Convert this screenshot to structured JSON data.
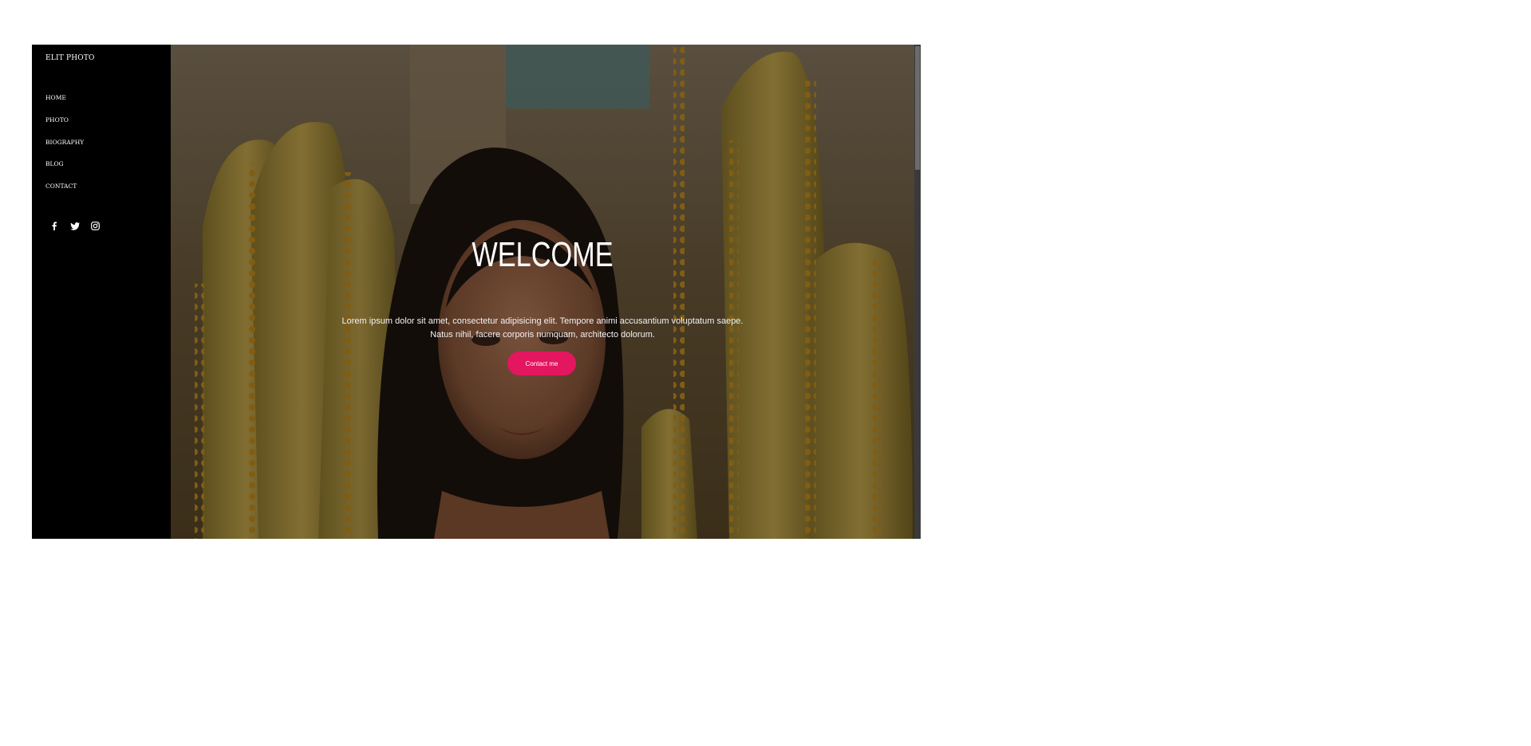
{
  "brand": "ELIT PHOTO",
  "nav": {
    "items": [
      {
        "label": "HOME"
      },
      {
        "label": "PHOTO"
      },
      {
        "label": "BIOGRAPHY"
      },
      {
        "label": "BLOG"
      },
      {
        "label": "CONTACT"
      }
    ]
  },
  "social": {
    "icons": [
      "facebook-icon",
      "twitter-icon",
      "instagram-icon"
    ]
  },
  "hero": {
    "title": "WELCOME",
    "description_line1": "Lorem ipsum dolor sit amet, consectetur adipisicing elit. Tempore animi accusantium voluptatum saepe.",
    "description_line2": "Natus nihil, facere corporis numquam, architecto dolorum.",
    "cta_label": "Contact me"
  },
  "colors": {
    "accent": "#e3165f",
    "sidebar_bg": "#000000"
  }
}
